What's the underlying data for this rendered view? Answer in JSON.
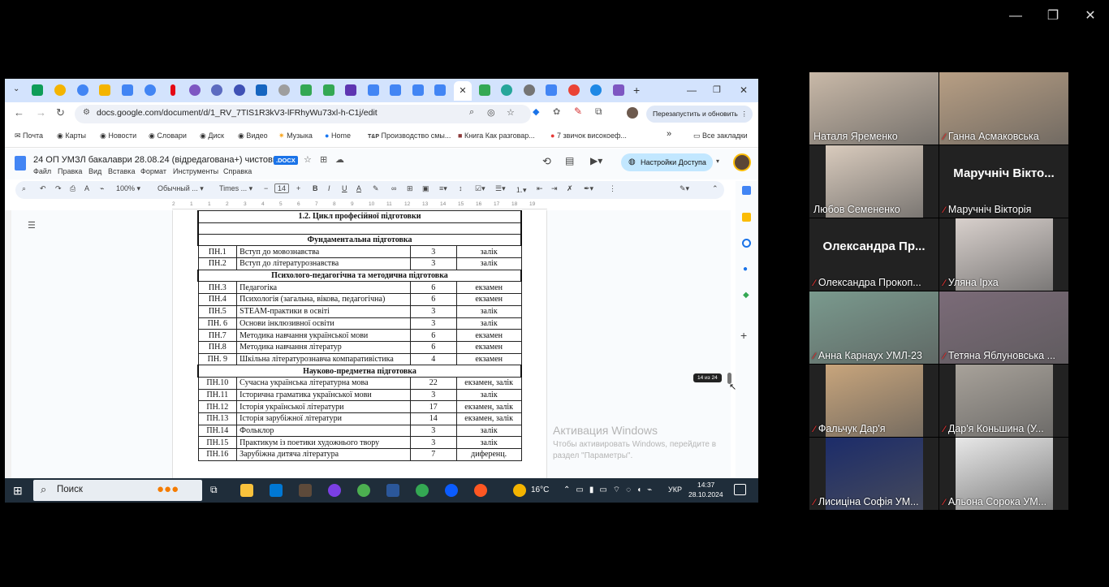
{
  "window_controls": {
    "minimize": "—",
    "restore": "❐",
    "close": "✕"
  },
  "browser": {
    "tabs": [
      {
        "icon": "sheets-icon",
        "color": "#0f9d58"
      },
      {
        "icon": "slides-icon",
        "color": "#f4b400"
      },
      {
        "icon": "docs-icon",
        "color": "#4285f4"
      },
      {
        "icon": "netflix-icon",
        "color": "#e50914"
      },
      {
        "icon": "drive-icon",
        "color": "#34a853"
      },
      {
        "icon": "docs-icon",
        "color": "#4285f4"
      },
      {
        "icon": "close-icon",
        "color": "#444"
      }
    ],
    "address": {
      "url": "docs.google.com/document/d/1_RV_7TIS1R3kV3-lFRhyWu73xl-h-C1j/edit",
      "relaunch_label": "Перезапустить и обновить"
    },
    "bookmarks": [
      "Почта",
      "Карты",
      "Новости",
      "Словари",
      "Диск",
      "Видео",
      "Музыка",
      "Home",
      "Производство смы...",
      "Книга Как разговар...",
      "7 звичок високоеф..."
    ],
    "all_bookmarks": "Все закладки"
  },
  "doc": {
    "title": "24 ОП УМЗЛ бакалаври 28.08.24 (відредагована+) чистовик",
    "badge": ".DOCX",
    "menu": [
      "Файл",
      "Правка",
      "Вид",
      "Вставка",
      "Формат",
      "Инструменты",
      "Справка"
    ],
    "access_label": "Настройки Доступа",
    "toolbar": {
      "zoom": "100%",
      "style": "Обычный ...",
      "font": "Times ...",
      "size": "14"
    },
    "ruler_ticks": [
      "2",
      "1",
      "1",
      "2",
      "3",
      "4",
      "5",
      "6",
      "7",
      "8",
      "9",
      "10",
      "11",
      "12",
      "13",
      "14",
      "15",
      "16",
      "17",
      "18",
      "19"
    ],
    "sections": {
      "cycle": "1.2. Цикл професійної підготовки",
      "fundamental": "Фундаментальна підготовка",
      "psych": "Психолого-педагогічна та методична підготовка",
      "science": "Науково-предметна підготовка"
    },
    "rows_fundamental": [
      {
        "code": "ПН.1",
        "name": "Вступ до мовознавства",
        "credits": "3",
        "control": "залік"
      },
      {
        "code": "ПН.2",
        "name": "Вступ до літературознавства",
        "credits": "3",
        "control": "залік"
      }
    ],
    "rows_psych": [
      {
        "code": "ПН.3",
        "name": "Педагогіка",
        "credits": "6",
        "control": "екзамен"
      },
      {
        "code": "ПН.4",
        "name": "Психологія (загальна, вікова, педагогічна)",
        "credits": "6",
        "control": "екзамен"
      },
      {
        "code": "ПН.5",
        "name": "STEAM-практики в освіті",
        "credits": "3",
        "control": "залік"
      },
      {
        "code": "ПН. 6",
        "name": "Основи інклюзивної освіти",
        "credits": "3",
        "control": "залік"
      },
      {
        "code": "ПН.7",
        "name": "Методика навчання української мови",
        "credits": "6",
        "control": "екзамен"
      },
      {
        "code": "ПН.8",
        "name": "Методика навчання літератур",
        "credits": "6",
        "control": "екзамен"
      },
      {
        "code": "ПН. 9",
        "name": "Шкільна літературознавча компаративістика",
        "credits": "4",
        "control": "екзамен"
      }
    ],
    "rows_science": [
      {
        "code": "ПН.10",
        "name": "Сучасна українська літературна мова",
        "credits": "22",
        "control": "екзамен, залік"
      },
      {
        "code": "ПН.11",
        "name": "Історична граматика української мови",
        "credits": "3",
        "control": "залік"
      },
      {
        "code": "ПН.12",
        "name": "Історія української літератури",
        "credits": "17",
        "control": "екзамен, залік"
      },
      {
        "code": "ПН.13",
        "name": "Історія зарубіжної літератури",
        "credits": "14",
        "control": "екзамен, залік"
      },
      {
        "code": "ПН.14",
        "name": "Фольклор",
        "credits": "3",
        "control": "залік"
      },
      {
        "code": "ПН.15",
        "name": "Практикум із поетики художнього твору",
        "credits": "3",
        "control": "залік"
      },
      {
        "code": "ПН.16",
        "name": "Зарубіжна дитяча література",
        "credits": "7",
        "control": "диференц."
      }
    ],
    "page_badge": "14 из 24",
    "watermark_title": "Активация Windows",
    "watermark_text": "Чтобы активировать Windows, перейдите в раздел \"Параметры\"."
  },
  "taskbar": {
    "search_label": "Поиск",
    "weather": "16°C",
    "lang": "УКР",
    "time": "14:37",
    "date": "28.10.2024"
  },
  "participants": [
    {
      "name": "Наталя Яременко",
      "muted": false,
      "video": true,
      "active": true,
      "bg": "#c9b9a8"
    },
    {
      "name": "Ганна Асмаковська",
      "muted": true,
      "video": true,
      "active": false,
      "bg": "#b89f84"
    },
    {
      "name": "Любов Семененко",
      "muted": false,
      "video": true,
      "active": false,
      "bg": "#d9cbbd"
    },
    {
      "name": "Маручніч Вікторія",
      "big_name": "Маручніч Вікто...",
      "muted": true,
      "video": false,
      "active": false,
      "bg": "#232323"
    },
    {
      "name": "Олександра Прокоп...",
      "big_name": "Олександра  Пр...",
      "muted": true,
      "video": false,
      "active": false,
      "bg": "#232323"
    },
    {
      "name": "Уляна Ірха",
      "muted": true,
      "video": true,
      "active": false,
      "bg": "#d8d0cc"
    },
    {
      "name": "Анна Карнаух УМЛ-23",
      "muted": true,
      "video": true,
      "active": false,
      "bg": "#7a9a8e"
    },
    {
      "name": "Тетяна Яблуновська ...",
      "muted": true,
      "video": true,
      "active": false,
      "bg": "#7b6b78"
    },
    {
      "name": "Фальчук Дар'я",
      "muted": true,
      "video": true,
      "active": false,
      "bg": "#c8a57c"
    },
    {
      "name": "Дар'я Коньшина (У...",
      "muted": true,
      "video": true,
      "active": false,
      "bg": "#a8a29a"
    },
    {
      "name": "Лисиціна Софія УМ...",
      "muted": true,
      "video": true,
      "active": false,
      "bg": "#1c2c6a"
    },
    {
      "name": "Альона Сорока  УМ...",
      "muted": true,
      "video": true,
      "active": false,
      "bg": "#e8e8e8"
    }
  ]
}
